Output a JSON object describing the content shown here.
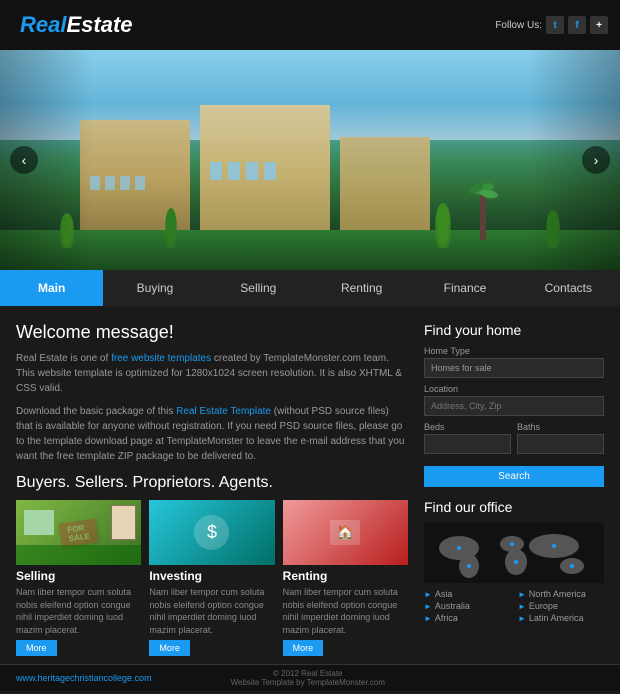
{
  "header": {
    "logo_real": "Real",
    "logo_estate": "Estate",
    "follow_label": "Follow Us:"
  },
  "nav": {
    "items": [
      {
        "label": "Main",
        "active": true
      },
      {
        "label": "Buying",
        "active": false
      },
      {
        "label": "Selling",
        "active": false
      },
      {
        "label": "Renting",
        "active": false
      },
      {
        "label": "Finance",
        "active": false
      },
      {
        "label": "Contacts",
        "active": false
      }
    ]
  },
  "main": {
    "welcome_title": "Welcome message!",
    "welcome_p1": "Real Estate is one of free website templates created by TemplateMonster.com team. This website template is optimized for 1280x1024 screen resolution. It is also XHTML & CSS valid.",
    "welcome_p2": "Download the basic package of this Real Estate Template (without PSD source files) that is available for anyone without registration. If you need PSD source files, please go to the template download page at TemplateMonster to leave the e-mail address that you want the free template ZIP package to be delivered to.",
    "section_title": "Buyers. Sellers. Proprietors. Agents.",
    "cards": [
      {
        "type": "selling",
        "title": "Selling",
        "text": "Nam liber tempor cum soluta nobis eleifend option congue nihil imperdiet doming iuod mazim placerat."
      },
      {
        "type": "investing",
        "title": "Investing",
        "text": "Nam liber tempor cum soluta nobis eleifend option congue nihil imperdiet doming iuod mazim placerat."
      },
      {
        "type": "renting",
        "title": "Renting",
        "text": "Nam liber tempor cum soluta nobis eleifend option congue nihil imperdiet doming iuod mazim placerat."
      }
    ],
    "more_label": "More"
  },
  "sidebar": {
    "find_title": "Find your home",
    "home_type_label": "Home Type",
    "home_type_placeholder": "Homes for sale",
    "location_label": "Location",
    "location_placeholder": "Address, City, Zip",
    "beds_label": "Beds",
    "beds_placeholder": "",
    "baths_label": "Baths",
    "baths_placeholder": "",
    "search_label": "Search",
    "office_title": "Find our office",
    "office_regions": [
      {
        "label": "Asia"
      },
      {
        "label": "Australia"
      },
      {
        "label": "Africa"
      },
      {
        "label": "North America"
      },
      {
        "label": "Europe"
      },
      {
        "label": "Latin America"
      }
    ]
  },
  "footer": {
    "url": "www.heritagechristiancollege.com",
    "copy": "© 2012 Real Estate",
    "template": "Website Template by TemplateMonster.com"
  }
}
